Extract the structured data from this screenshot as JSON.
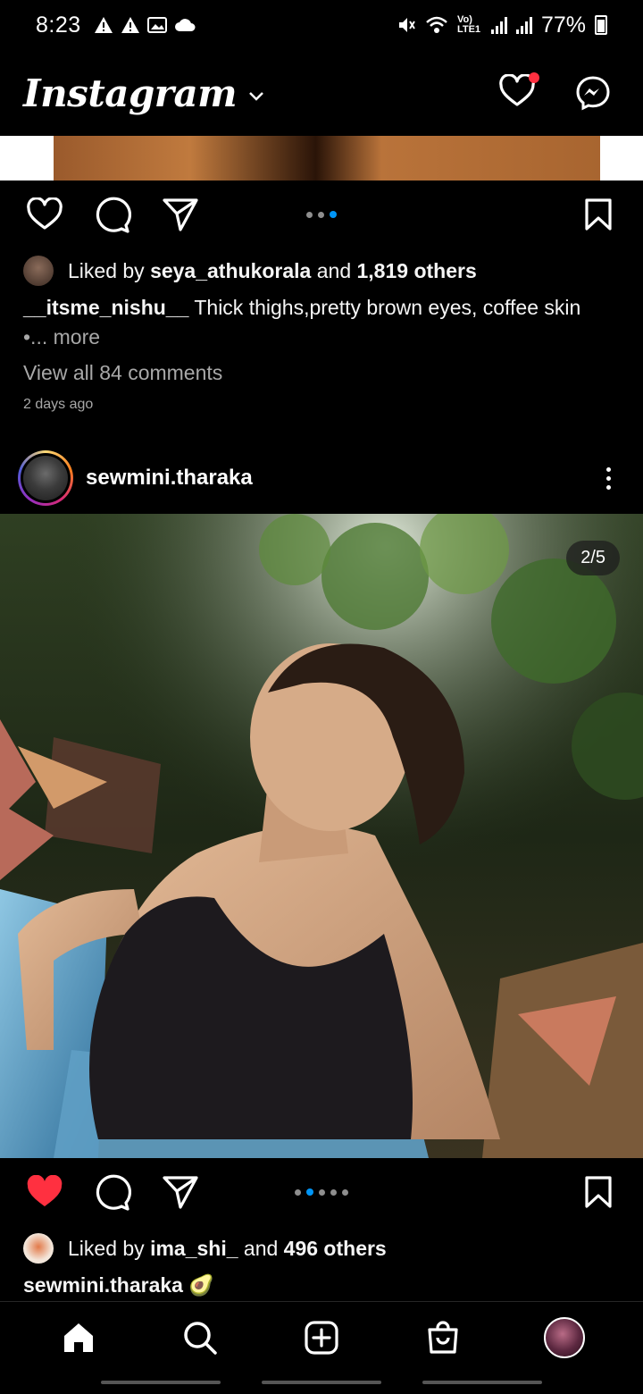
{
  "status_bar": {
    "time": "8:23",
    "network_label": "Vo) LTE1",
    "battery": "77%"
  },
  "header": {
    "logo": "Instagram",
    "has_notification": true
  },
  "previous_post": {
    "liked_by_prefix": "Liked by ",
    "liked_by_user": "seya_athukorala",
    "liked_by_mid": " and ",
    "liked_by_others": "1,819 others",
    "caption_user": "__itsme_nishu__",
    "caption_text": " Thick thighs,pretty brown eyes, coffee skin",
    "caption_more": "•... more",
    "view_comments": "View all 84 comments",
    "timestamp": "2 days ago",
    "carousel_active_index": 2,
    "carousel_count": 3
  },
  "post": {
    "username": "sewmini.tharaka",
    "counter": "2/5",
    "liked": true,
    "liked_by_prefix": "Liked by ",
    "liked_by_user": "ima_shi_",
    "liked_by_mid": " and ",
    "liked_by_others": "496 others",
    "caption_user": "sewmini.tharaka",
    "caption_emoji": "🥑",
    "carousel_active_index": 1,
    "carousel_count": 5
  },
  "colors": {
    "like_red": "#ff3040",
    "carousel_blue": "#0095f6",
    "muted_text": "#a8a8a8"
  },
  "bottom_nav": [
    "home-icon",
    "search-icon",
    "new-post-icon",
    "shop-icon",
    "profile-avatar"
  ]
}
